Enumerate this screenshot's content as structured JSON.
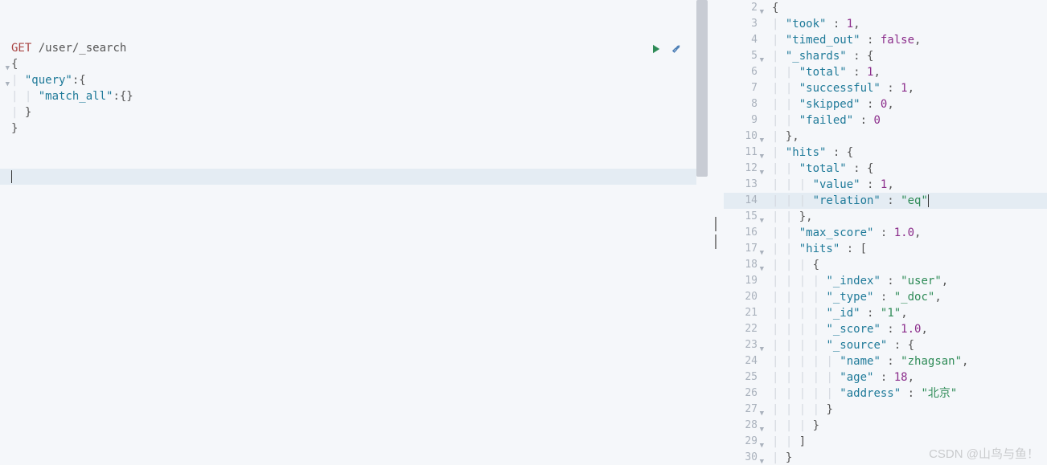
{
  "request": {
    "method": "GET",
    "path": "/user/_search",
    "lines": [
      {
        "indent": 0,
        "text": "{",
        "fold": true
      },
      {
        "indent": 1,
        "key": "query",
        "after": ":{",
        "fold": true
      },
      {
        "indent": 2,
        "key": "match_all",
        "after": ":{}"
      },
      {
        "indent": 1,
        "text": "}"
      },
      {
        "indent": 0,
        "text": "}"
      }
    ]
  },
  "response_gutter": [
    "2",
    "3",
    "4",
    "5",
    "6",
    "7",
    "8",
    "9",
    "10",
    "11",
    "12",
    "13",
    "14",
    "15",
    "16",
    "17",
    "18",
    "19",
    "20",
    "21",
    "22",
    "23",
    "24",
    "25",
    "26",
    "27",
    "28",
    "29",
    "30"
  ],
  "response_folds": [
    true,
    false,
    false,
    true,
    false,
    false,
    false,
    false,
    true,
    true,
    true,
    false,
    false,
    true,
    false,
    true,
    true,
    false,
    false,
    false,
    false,
    true,
    false,
    false,
    false,
    true,
    true,
    true,
    true
  ],
  "chart_data": {
    "type": "table",
    "title": "Elasticsearch _search response",
    "series": [
      {
        "name": "took",
        "values": [
          1
        ]
      },
      {
        "name": "timed_out",
        "values": [
          false
        ]
      },
      {
        "name": "_shards.total",
        "values": [
          1
        ]
      },
      {
        "name": "_shards.successful",
        "values": [
          1
        ]
      },
      {
        "name": "_shards.skipped",
        "values": [
          0
        ]
      },
      {
        "name": "_shards.failed",
        "values": [
          0
        ]
      },
      {
        "name": "hits.total.value",
        "values": [
          1
        ]
      },
      {
        "name": "hits.total.relation",
        "values": [
          "eq"
        ]
      },
      {
        "name": "hits.max_score",
        "values": [
          1.0
        ]
      },
      {
        "name": "hits.hits[0]._index",
        "values": [
          "user"
        ]
      },
      {
        "name": "hits.hits[0]._type",
        "values": [
          "_doc"
        ]
      },
      {
        "name": "hits.hits[0]._id",
        "values": [
          "1"
        ]
      },
      {
        "name": "hits.hits[0]._score",
        "values": [
          1.0
        ]
      },
      {
        "name": "hits.hits[0]._source.name",
        "values": [
          "zhagsan"
        ]
      },
      {
        "name": "hits.hits[0]._source.age",
        "values": [
          18
        ]
      },
      {
        "name": "hits.hits[0]._source.address",
        "values": [
          "北京"
        ]
      }
    ]
  },
  "response_lines": [
    {
      "i": 0,
      "raw": "{"
    },
    {
      "i": 1,
      "k": "took",
      "v": "1",
      "t": "num",
      "comma": true
    },
    {
      "i": 1,
      "k": "timed_out",
      "v": "false",
      "t": "bool",
      "comma": true
    },
    {
      "i": 1,
      "k": "_shards",
      "open": "{"
    },
    {
      "i": 2,
      "k": "total",
      "v": "1",
      "t": "num",
      "comma": true
    },
    {
      "i": 2,
      "k": "successful",
      "v": "1",
      "t": "num",
      "comma": true
    },
    {
      "i": 2,
      "k": "skipped",
      "v": "0",
      "t": "num",
      "comma": true
    },
    {
      "i": 2,
      "k": "failed",
      "v": "0",
      "t": "num"
    },
    {
      "i": 1,
      "raw": "},"
    },
    {
      "i": 1,
      "k": "hits",
      "open": "{"
    },
    {
      "i": 2,
      "k": "total",
      "open": "{"
    },
    {
      "i": 3,
      "k": "value",
      "v": "1",
      "t": "num",
      "comma": true
    },
    {
      "i": 3,
      "k": "relation",
      "v": "eq",
      "t": "str",
      "cursor": true
    },
    {
      "i": 2,
      "raw": "},"
    },
    {
      "i": 2,
      "k": "max_score",
      "v": "1.0",
      "t": "num",
      "comma": true
    },
    {
      "i": 2,
      "k": "hits",
      "open": "["
    },
    {
      "i": 3,
      "raw": "{"
    },
    {
      "i": 4,
      "k": "_index",
      "v": "user",
      "t": "str",
      "comma": true
    },
    {
      "i": 4,
      "k": "_type",
      "v": "_doc",
      "t": "str",
      "comma": true
    },
    {
      "i": 4,
      "k": "_id",
      "v": "1",
      "t": "str",
      "comma": true
    },
    {
      "i": 4,
      "k": "_score",
      "v": "1.0",
      "t": "num",
      "comma": true
    },
    {
      "i": 4,
      "k": "_source",
      "open": "{"
    },
    {
      "i": 5,
      "k": "name",
      "v": "zhagsan",
      "t": "str",
      "comma": true
    },
    {
      "i": 5,
      "k": "age",
      "v": "18",
      "t": "num",
      "comma": true
    },
    {
      "i": 5,
      "k": "address",
      "v": "北京",
      "t": "str"
    },
    {
      "i": 4,
      "raw": "}"
    },
    {
      "i": 3,
      "raw": "}"
    },
    {
      "i": 2,
      "raw": "]"
    },
    {
      "i": 1,
      "raw": "}"
    }
  ],
  "watermark": "CSDN @山鸟与鱼！"
}
